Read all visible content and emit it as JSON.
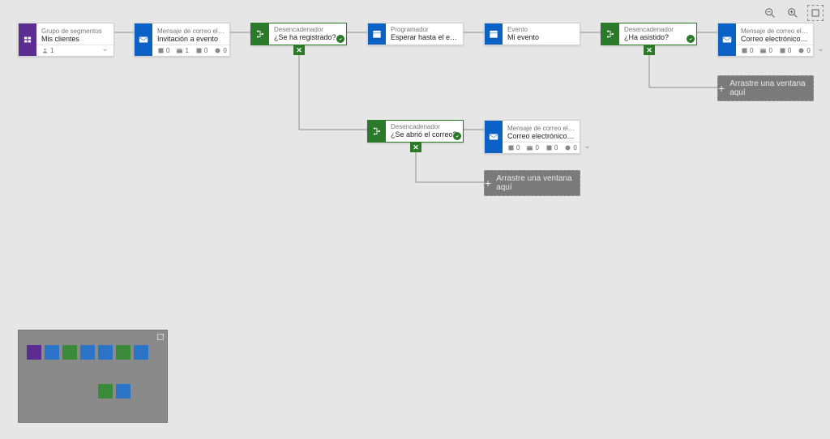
{
  "toolbar": {
    "zoom_out": "zoom-out",
    "zoom_in": "zoom-in",
    "fit": "fit-to-screen"
  },
  "tiles": {
    "segment": {
      "label": "Grupo de segmentos",
      "value": "Mis clientes",
      "count": "1"
    },
    "email1": {
      "label": "Mensaje de correo electrónico d…",
      "value": "Invitación a evento",
      "s1": "0",
      "s2": "1",
      "s3": "0",
      "s4": "0"
    },
    "trigger1": {
      "label": "Desencadenador",
      "value": "¿Se ha registrado?"
    },
    "scheduler": {
      "label": "Programador",
      "value": "Esperar hasta el evento"
    },
    "event": {
      "label": "Evento",
      "value": "Mi evento"
    },
    "trigger2": {
      "label": "Desencadenador",
      "value": "¿Ha asistido?"
    },
    "email2": {
      "label": "Mensaje de correo electrónico d…",
      "value": "Correo electrónico de agradec…",
      "s1": "0",
      "s2": "0",
      "s3": "0",
      "s4": "0"
    },
    "trigger3": {
      "label": "Desencadenador",
      "value": "¿Se abrió el correo?"
    },
    "email3": {
      "label": "Mensaje de correo electrónico d…",
      "value": "Correo electrónico de recordat…",
      "s1": "0",
      "s2": "0",
      "s3": "0",
      "s4": "0"
    }
  },
  "branch_label": "✕",
  "drop_label": "Arrastre una ventana aquí"
}
